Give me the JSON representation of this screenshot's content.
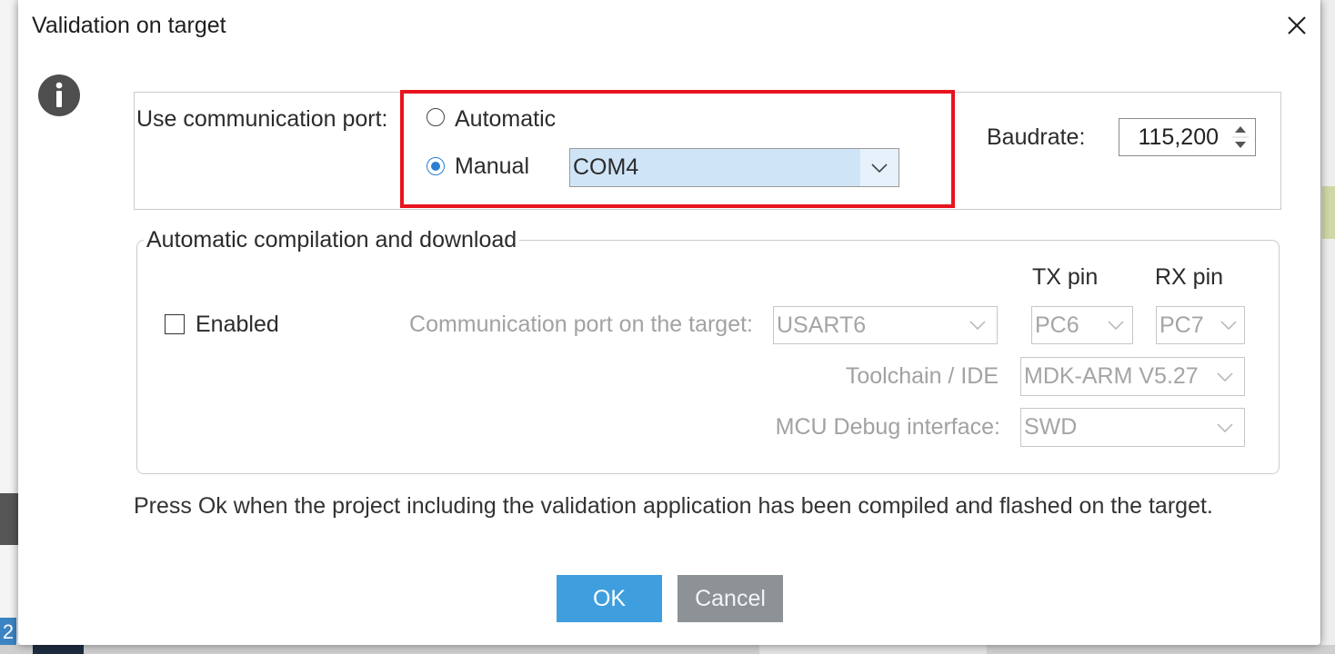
{
  "window": {
    "title": "Validation on target",
    "close_icon": "close-icon"
  },
  "info_icon": "info-icon",
  "port": {
    "label": "Use communication port:",
    "options": [
      {
        "label": "Automatic",
        "selected": false
      },
      {
        "label": "Manual",
        "selected": true
      }
    ],
    "com_port": "COM4"
  },
  "baudrate": {
    "label": "Baudrate:",
    "value": "115,200"
  },
  "auto_compile": {
    "legend": "Automatic compilation and download",
    "disabled": true,
    "enabled": {
      "label": "Enabled",
      "checked": false
    },
    "tx_header": "TX pin",
    "rx_header": "RX pin",
    "comm_port": {
      "label": "Communication port on the target:",
      "value": "USART6",
      "tx": "PC6",
      "rx": "PC7"
    },
    "toolchain": {
      "label": "Toolchain / IDE",
      "value": "MDK-ARM V5.27"
    },
    "debug_interface": {
      "label": "MCU Debug interface:",
      "value": "SWD"
    }
  },
  "message": "Press Ok when the project including the validation application has been compiled and flashed on the target.",
  "buttons": {
    "ok": "OK",
    "cancel": "Cancel"
  },
  "background": {
    "taskbar_badge": "2"
  },
  "colors": {
    "highlight_border": "#e8141e",
    "ok_button": "#3f9fde",
    "cancel_button": "#8c9296",
    "radio_selected": "#2b7fd2",
    "combo_selected_bg": "#cfe5f7"
  }
}
